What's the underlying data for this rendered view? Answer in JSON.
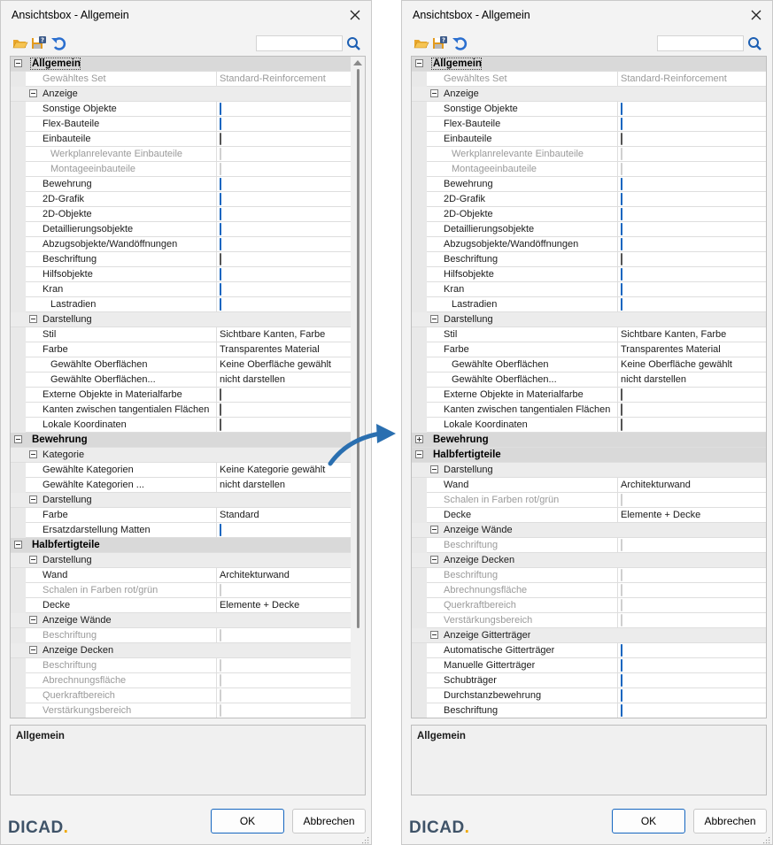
{
  "dialogs": [
    {
      "id": "left",
      "title": "Ansichtsbox - Allgemein",
      "search": {
        "value": "",
        "placeholder": ""
      },
      "rows": [
        {
          "type": "cat",
          "label": "Allgemein",
          "expanded": true,
          "selected": true
        },
        {
          "type": "prop",
          "label": "Gewähltes Set",
          "level": 1,
          "text": "Standard-Reinforcement",
          "disabled": true
        },
        {
          "type": "sub",
          "label": "Anzeige",
          "expanded": true
        },
        {
          "type": "prop",
          "label": "Sonstige Objekte",
          "level": 1,
          "check": true
        },
        {
          "type": "prop",
          "label": "Flex-Bauteile",
          "level": 1,
          "check": true
        },
        {
          "type": "prop",
          "label": "Einbauteile",
          "level": 1,
          "check": false
        },
        {
          "type": "prop",
          "label": "Werkplanrelevante Einbauteile",
          "level": 2,
          "check": true,
          "disabled": true
        },
        {
          "type": "prop",
          "label": "Montageeinbauteile",
          "level": 2,
          "check": true,
          "disabled": true
        },
        {
          "type": "prop",
          "label": "Bewehrung",
          "level": 1,
          "check": true
        },
        {
          "type": "prop",
          "label": "2D-Grafik",
          "level": 1,
          "check": true
        },
        {
          "type": "prop",
          "label": "2D-Objekte",
          "level": 1,
          "check": true
        },
        {
          "type": "prop",
          "label": "Detaillierungsobjekte",
          "level": 1,
          "check": true
        },
        {
          "type": "prop",
          "label": "Abzugsobjekte/Wandöffnungen",
          "level": 1,
          "check": true
        },
        {
          "type": "prop",
          "label": "Beschriftung",
          "level": 1,
          "check": false
        },
        {
          "type": "prop",
          "label": "Hilfsobjekte",
          "level": 1,
          "check": true
        },
        {
          "type": "prop",
          "label": "Kran",
          "level": 1,
          "check": true
        },
        {
          "type": "prop",
          "label": "Lastradien",
          "level": 2,
          "check": true
        },
        {
          "type": "sub",
          "label": "Darstellung",
          "expanded": true
        },
        {
          "type": "prop",
          "label": "Stil",
          "level": 1,
          "text": "Sichtbare Kanten, Farbe"
        },
        {
          "type": "prop",
          "label": "Farbe",
          "level": 1,
          "text": "Transparentes Material"
        },
        {
          "type": "prop",
          "label": "Gewählte Oberflächen",
          "level": 2,
          "text": "Keine Oberfläche gewählt"
        },
        {
          "type": "prop",
          "label": "Gewählte Oberflächen...",
          "level": 2,
          "text": "nicht darstellen"
        },
        {
          "type": "prop",
          "label": "Externe Objekte in Materialfarbe",
          "level": 1,
          "check": false
        },
        {
          "type": "prop",
          "label": "Kanten zwischen tangentialen Flächen",
          "level": 1,
          "check": false
        },
        {
          "type": "prop",
          "label": "Lokale Koordinaten",
          "level": 1,
          "check": false
        },
        {
          "type": "cat",
          "label": "Bewehrung",
          "expanded": true
        },
        {
          "type": "sub",
          "label": "Kategorie",
          "expanded": true
        },
        {
          "type": "prop",
          "label": "Gewählte Kategorien",
          "level": 1,
          "text": "Keine Kategorie gewählt"
        },
        {
          "type": "prop",
          "label": "Gewählte Kategorien ...",
          "level": 1,
          "text": "nicht darstellen"
        },
        {
          "type": "sub",
          "label": "Darstellung",
          "expanded": true
        },
        {
          "type": "prop",
          "label": "Farbe",
          "level": 1,
          "text": "Standard"
        },
        {
          "type": "prop",
          "label": "Ersatzdarstellung Matten",
          "level": 1,
          "check": true
        },
        {
          "type": "cat",
          "label": "Halbfertigteile",
          "expanded": true
        },
        {
          "type": "sub",
          "label": "Darstellung",
          "expanded": true
        },
        {
          "type": "prop",
          "label": "Wand",
          "level": 1,
          "text": "Architekturwand"
        },
        {
          "type": "prop",
          "label": "Schalen in Farben rot/grün",
          "level": 1,
          "check": true,
          "disabled": true
        },
        {
          "type": "prop",
          "label": "Decke",
          "level": 1,
          "text": "Elemente + Decke"
        },
        {
          "type": "sub",
          "label": "Anzeige Wände",
          "expanded": true
        },
        {
          "type": "prop",
          "label": "Beschriftung",
          "level": 1,
          "check": false,
          "disabled": true
        },
        {
          "type": "sub",
          "label": "Anzeige Decken",
          "expanded": true
        },
        {
          "type": "prop",
          "label": "Beschriftung",
          "level": 1,
          "check": false,
          "disabled": true
        },
        {
          "type": "prop",
          "label": "Abrechnungsfläche",
          "level": 1,
          "check": false,
          "disabled": true
        },
        {
          "type": "prop",
          "label": "Querkraftbereich",
          "level": 1,
          "check": false,
          "disabled": true
        },
        {
          "type": "prop",
          "label": "Verstärkungsbereich",
          "level": 1,
          "check": false,
          "disabled": true
        }
      ],
      "description_title": "Allgemein",
      "ok_label": "OK",
      "cancel_label": "Abbrechen",
      "logo_text": "DICAD",
      "logo_dot": "."
    },
    {
      "id": "right",
      "title": "Ansichtsbox - Allgemein",
      "search": {
        "value": "",
        "placeholder": ""
      },
      "rows": [
        {
          "type": "cat",
          "label": "Allgemein",
          "expanded": true,
          "selected": true
        },
        {
          "type": "prop",
          "label": "Gewähltes Set",
          "level": 1,
          "text": "Standard-Reinforcement",
          "disabled": true
        },
        {
          "type": "sub",
          "label": "Anzeige",
          "expanded": true
        },
        {
          "type": "prop",
          "label": "Sonstige Objekte",
          "level": 1,
          "check": true
        },
        {
          "type": "prop",
          "label": "Flex-Bauteile",
          "level": 1,
          "check": true
        },
        {
          "type": "prop",
          "label": "Einbauteile",
          "level": 1,
          "check": false
        },
        {
          "type": "prop",
          "label": "Werkplanrelevante Einbauteile",
          "level": 2,
          "check": true,
          "disabled": true
        },
        {
          "type": "prop",
          "label": "Montageeinbauteile",
          "level": 2,
          "check": true,
          "disabled": true
        },
        {
          "type": "prop",
          "label": "Bewehrung",
          "level": 1,
          "check": true
        },
        {
          "type": "prop",
          "label": "2D-Grafik",
          "level": 1,
          "check": true
        },
        {
          "type": "prop",
          "label": "2D-Objekte",
          "level": 1,
          "check": true
        },
        {
          "type": "prop",
          "label": "Detaillierungsobjekte",
          "level": 1,
          "check": true
        },
        {
          "type": "prop",
          "label": "Abzugsobjekte/Wandöffnungen",
          "level": 1,
          "check": true
        },
        {
          "type": "prop",
          "label": "Beschriftung",
          "level": 1,
          "check": false
        },
        {
          "type": "prop",
          "label": "Hilfsobjekte",
          "level": 1,
          "check": true
        },
        {
          "type": "prop",
          "label": "Kran",
          "level": 1,
          "check": true
        },
        {
          "type": "prop",
          "label": "Lastradien",
          "level": 2,
          "check": true
        },
        {
          "type": "sub",
          "label": "Darstellung",
          "expanded": true
        },
        {
          "type": "prop",
          "label": "Stil",
          "level": 1,
          "text": "Sichtbare Kanten, Farbe"
        },
        {
          "type": "prop",
          "label": "Farbe",
          "level": 1,
          "text": "Transparentes Material"
        },
        {
          "type": "prop",
          "label": "Gewählte Oberflächen",
          "level": 2,
          "text": "Keine Oberfläche gewählt"
        },
        {
          "type": "prop",
          "label": "Gewählte Oberflächen...",
          "level": 2,
          "text": "nicht darstellen"
        },
        {
          "type": "prop",
          "label": "Externe Objekte in Materialfarbe",
          "level": 1,
          "check": false
        },
        {
          "type": "prop",
          "label": "Kanten zwischen tangentialen Flächen",
          "level": 1,
          "check": false
        },
        {
          "type": "prop",
          "label": "Lokale Koordinaten",
          "level": 1,
          "check": false
        },
        {
          "type": "cat",
          "label": "Bewehrung",
          "expanded": false
        },
        {
          "type": "cat",
          "label": "Halbfertigteile",
          "expanded": true
        },
        {
          "type": "sub",
          "label": "Darstellung",
          "expanded": true
        },
        {
          "type": "prop",
          "label": "Wand",
          "level": 1,
          "text": "Architekturwand"
        },
        {
          "type": "prop",
          "label": "Schalen in Farben rot/grün",
          "level": 1,
          "check": true,
          "disabled": true
        },
        {
          "type": "prop",
          "label": "Decke",
          "level": 1,
          "text": "Elemente + Decke"
        },
        {
          "type": "sub",
          "label": "Anzeige Wände",
          "expanded": true
        },
        {
          "type": "prop",
          "label": "Beschriftung",
          "level": 1,
          "check": false,
          "disabled": true
        },
        {
          "type": "sub",
          "label": "Anzeige Decken",
          "expanded": true
        },
        {
          "type": "prop",
          "label": "Beschriftung",
          "level": 1,
          "check": false,
          "disabled": true
        },
        {
          "type": "prop",
          "label": "Abrechnungsfläche",
          "level": 1,
          "check": false,
          "disabled": true
        },
        {
          "type": "prop",
          "label": "Querkraftbereich",
          "level": 1,
          "check": false,
          "disabled": true
        },
        {
          "type": "prop",
          "label": "Verstärkungsbereich",
          "level": 1,
          "check": false,
          "disabled": true
        },
        {
          "type": "sub",
          "label": "Anzeige Gitterträger",
          "expanded": true
        },
        {
          "type": "prop",
          "label": "Automatische Gitterträger",
          "level": 1,
          "check": true
        },
        {
          "type": "prop",
          "label": "Manuelle Gitterträger",
          "level": 1,
          "check": true
        },
        {
          "type": "prop",
          "label": "Schubträger",
          "level": 1,
          "check": true
        },
        {
          "type": "prop",
          "label": "Durchstanzbewehrung",
          "level": 1,
          "check": true
        },
        {
          "type": "prop",
          "label": "Beschriftung",
          "level": 1,
          "check": true
        }
      ],
      "description_title": "Allgemein",
      "ok_label": "OK",
      "cancel_label": "Abbrechen",
      "logo_text": "DICAD",
      "logo_dot": "."
    }
  ],
  "colors": {
    "accent": "#1566c0",
    "category_bg": "#d9d9d9",
    "subcategory_bg": "#ececec",
    "disabled_text": "#9a9a9a",
    "logo": "#3f5368",
    "logo_dot": "#f0a800",
    "arrow": "#2a6fb0"
  },
  "icons": {
    "toolbar": [
      "folder-open-icon",
      "save-settings-icon",
      "undo-icon"
    ],
    "search": "search-icon",
    "close": "close-icon",
    "transition_arrow": "curved-arrow-icon"
  }
}
